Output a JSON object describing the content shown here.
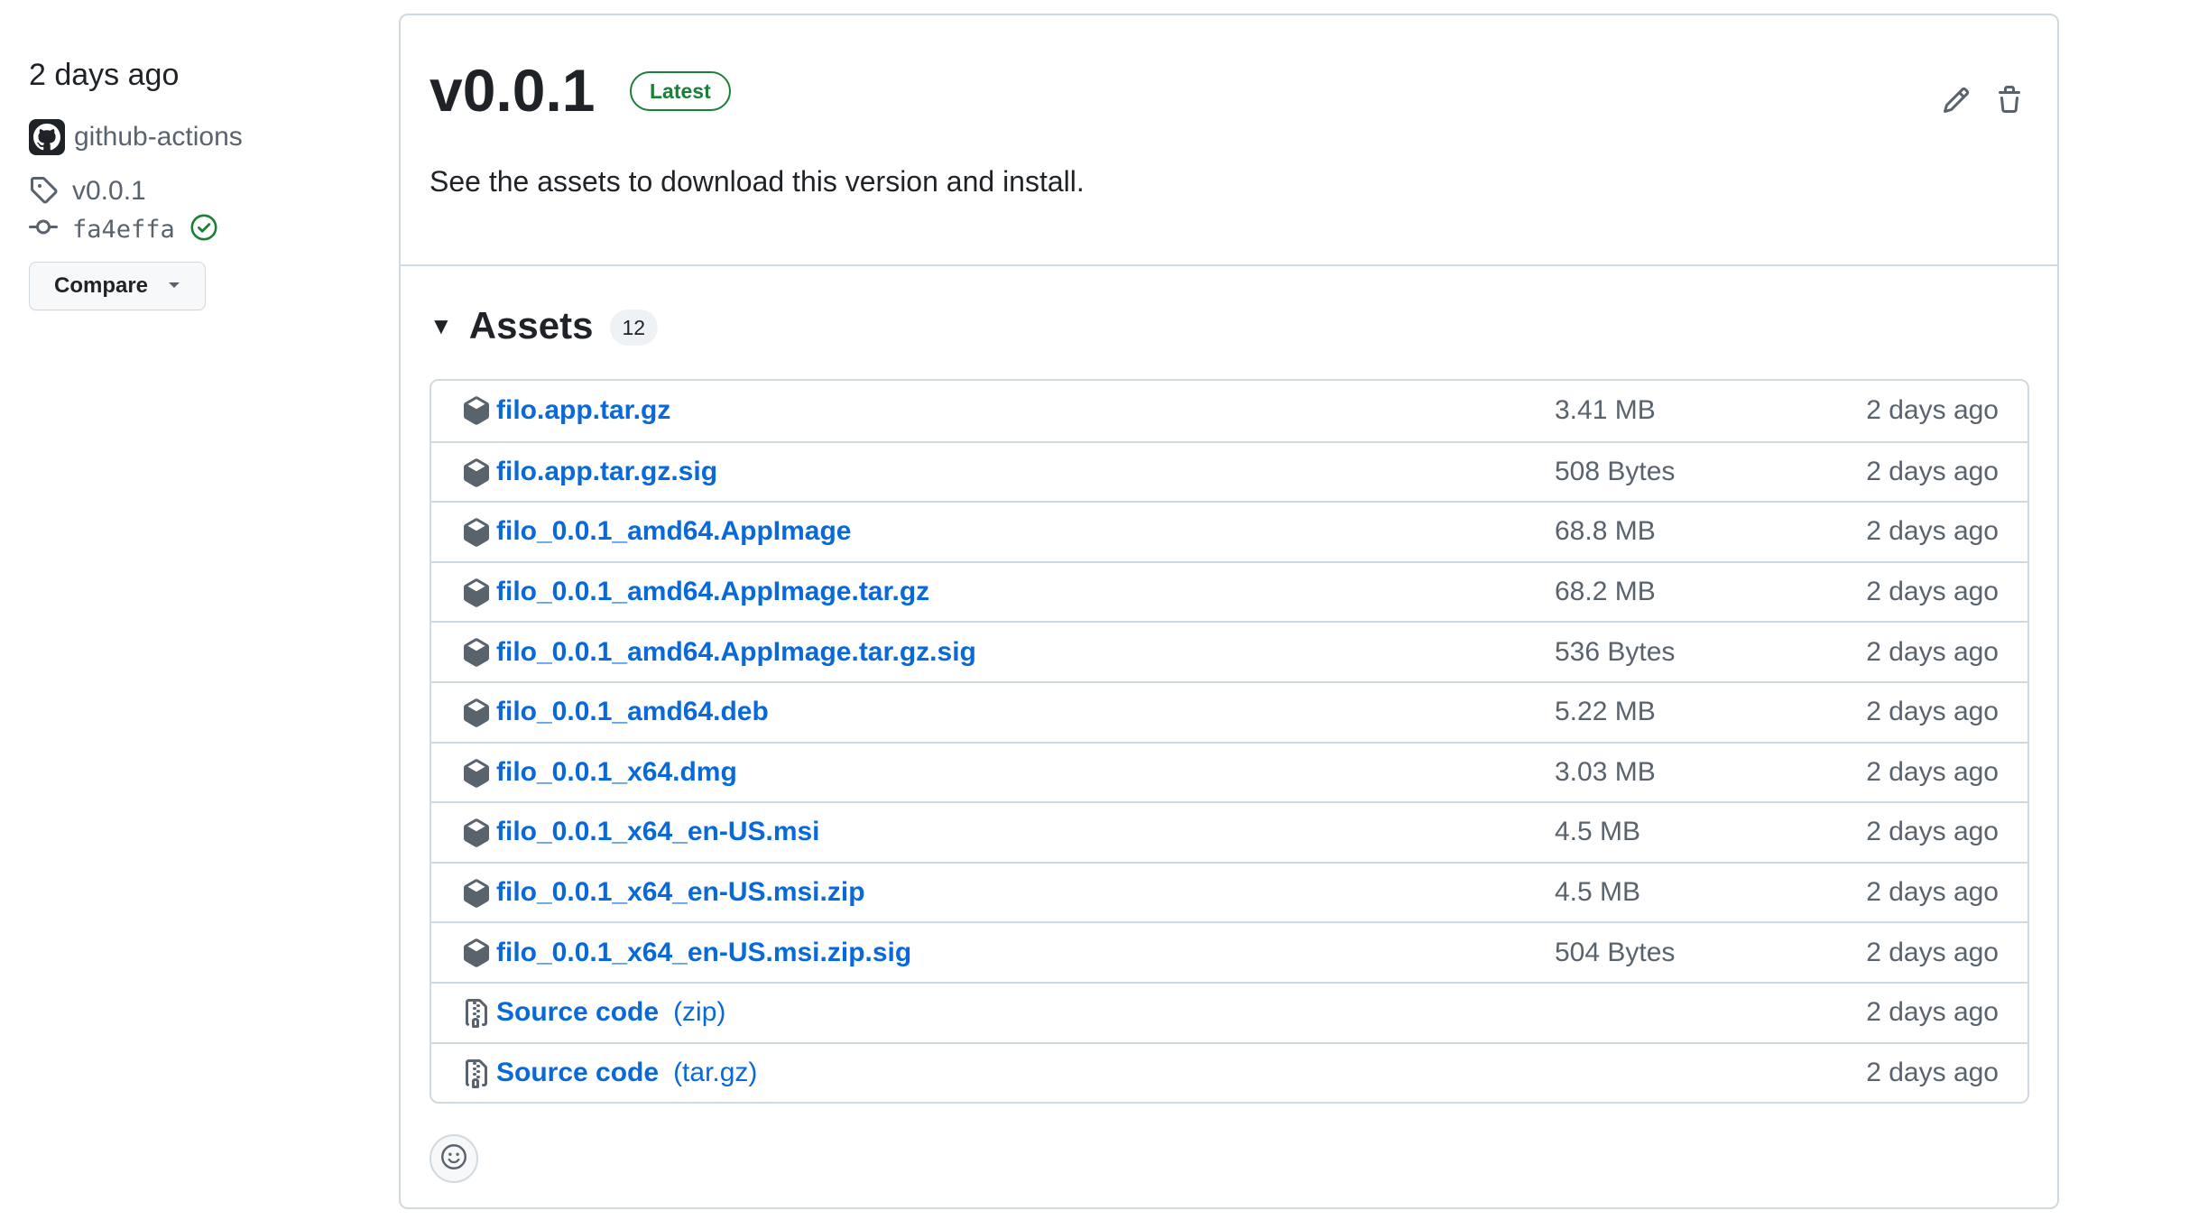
{
  "sidebar": {
    "date": "2 days ago",
    "author": "github-actions",
    "tag": "v0.0.1",
    "commit": "fa4effa",
    "compare_label": "Compare"
  },
  "release": {
    "title": "v0.0.1",
    "badge": "Latest",
    "description": "See the assets to download this version and install."
  },
  "assets": {
    "heading": "Assets",
    "count": "12",
    "items": [
      {
        "name": "filo.app.tar.gz",
        "size": "3.41 MB",
        "date": "2 days ago",
        "icon": "package-icon"
      },
      {
        "name": "filo.app.tar.gz.sig",
        "size": "508 Bytes",
        "date": "2 days ago",
        "icon": "package-icon"
      },
      {
        "name": "filo_0.0.1_amd64.AppImage",
        "size": "68.8 MB",
        "date": "2 days ago",
        "icon": "package-icon"
      },
      {
        "name": "filo_0.0.1_amd64.AppImage.tar.gz",
        "size": "68.2 MB",
        "date": "2 days ago",
        "icon": "package-icon"
      },
      {
        "name": "filo_0.0.1_amd64.AppImage.tar.gz.sig",
        "size": "536 Bytes",
        "date": "2 days ago",
        "icon": "package-icon"
      },
      {
        "name": "filo_0.0.1_amd64.deb",
        "size": "5.22 MB",
        "date": "2 days ago",
        "icon": "package-icon"
      },
      {
        "name": "filo_0.0.1_x64.dmg",
        "size": "3.03 MB",
        "date": "2 days ago",
        "icon": "package-icon"
      },
      {
        "name": "filo_0.0.1_x64_en-US.msi",
        "size": "4.5 MB",
        "date": "2 days ago",
        "icon": "package-icon"
      },
      {
        "name": "filo_0.0.1_x64_en-US.msi.zip",
        "size": "4.5 MB",
        "date": "2 days ago",
        "icon": "package-icon"
      },
      {
        "name": "filo_0.0.1_x64_en-US.msi.zip.sig",
        "size": "504 Bytes",
        "date": "2 days ago",
        "icon": "package-icon"
      },
      {
        "name": "Source code",
        "ext": "(zip)",
        "date": "2 days ago",
        "icon": "file-zip-icon"
      },
      {
        "name": "Source code",
        "ext": "(tar.gz)",
        "date": "2 days ago",
        "icon": "file-zip-icon"
      }
    ]
  },
  "colors": {
    "link": "#0969da",
    "badge_green": "#1a7f37",
    "muted_text": "#59636e",
    "border": "#d1d9e0"
  }
}
